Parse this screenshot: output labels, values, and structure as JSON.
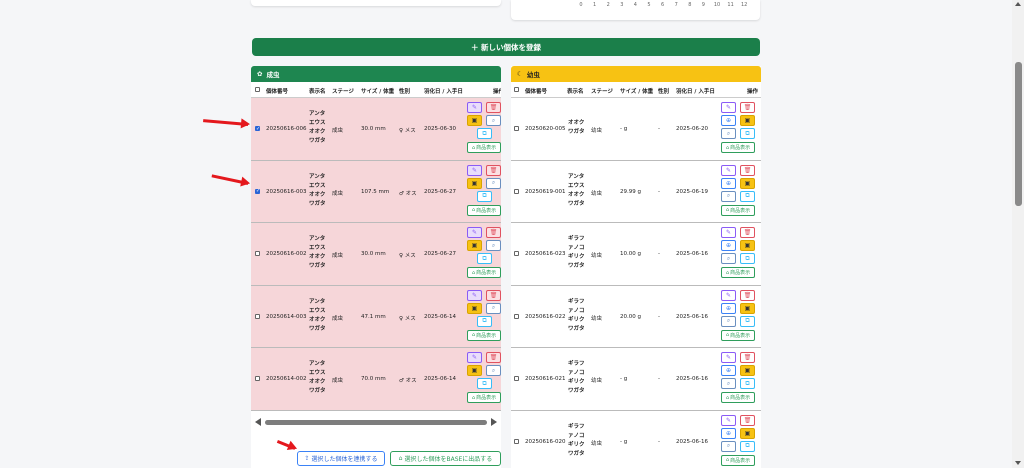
{
  "chart": {
    "x_ticks": [
      "0",
      "1",
      "2",
      "3",
      "4",
      "5",
      "6",
      "7",
      "8",
      "9",
      "10",
      "11",
      "12"
    ]
  },
  "add_button": {
    "label": "＋ 新しい個体を登録"
  },
  "columns": {
    "id": "個体番号",
    "name": "表示名",
    "stage": "ステージ",
    "size": "サイズ / 体重",
    "sex": "性別",
    "date": "羽化日 / 入手日",
    "actions": "操作"
  },
  "adults": {
    "title": "成虫",
    "rows": [
      {
        "checked": true,
        "id": "20250616-006",
        "name": "アンタエウスオオクワガタ",
        "stage": "成虫",
        "size": "30.0 mm",
        "sex": "♀ メス",
        "date": "2025-06-30"
      },
      {
        "checked": true,
        "id": "20250616-003",
        "name": "アンタエウスオオクワガタ",
        "stage": "成虫",
        "size": "107.5 mm",
        "sex": "♂ オス",
        "date": "2025-06-27"
      },
      {
        "checked": false,
        "id": "20250616-002",
        "name": "アンタエウスオオクワガタ",
        "stage": "成虫",
        "size": "30.0 mm",
        "sex": "♀ メス",
        "date": "2025-06-27"
      },
      {
        "checked": false,
        "id": "20250614-003",
        "name": "アンタエウスオオクワガタ",
        "stage": "成虫",
        "size": "47.1 mm",
        "sex": "♀ メス",
        "date": "2025-06-14"
      },
      {
        "checked": false,
        "id": "20250614-002",
        "name": "アンタエウスオオクワガタ",
        "stage": "成虫",
        "size": "70.0 mm",
        "sex": "♂ オス",
        "date": "2025-06-14"
      }
    ]
  },
  "larvae": {
    "title": "幼虫",
    "rows": [
      {
        "checked": false,
        "id": "20250620-005",
        "name": "オオクワガタ",
        "stage": "幼虫",
        "size": "- g",
        "sex": "-",
        "date": "2025-06-20"
      },
      {
        "checked": false,
        "id": "20250619-001",
        "name": "アンタエウスオオクワガタ",
        "stage": "幼虫",
        "size": "29.99 g",
        "sex": "-",
        "date": "2025-06-19"
      },
      {
        "checked": false,
        "id": "20250616-023",
        "name": "ギラファノコギリクワガタ",
        "stage": "幼虫",
        "size": "10.00 g",
        "sex": "-",
        "date": "2025-06-16"
      },
      {
        "checked": false,
        "id": "20250616-022",
        "name": "ギラファノコギリクワガタ",
        "stage": "幼虫",
        "size": "20.00 g",
        "sex": "-",
        "date": "2025-06-16"
      },
      {
        "checked": false,
        "id": "20250616-021",
        "name": "ギラファノコギリクワガタ",
        "stage": "幼虫",
        "size": "- g",
        "sex": "-",
        "date": "2025-06-16"
      },
      {
        "checked": false,
        "id": "20250616-020",
        "name": "ギラファノコギリクワガタ",
        "stage": "幼虫",
        "size": "- g",
        "sex": "-",
        "date": "2025-06-16"
      }
    ]
  },
  "actions": {
    "shop_label": "商品表示"
  },
  "bottom": {
    "link_label": "選択した個体を連携する",
    "base_label": "選択した個体をBASEに出品する"
  },
  "colors": {
    "adult_header": "#1e8650",
    "larva_header": "#f7c213",
    "adult_row": "#f6d6d9",
    "add_button": "#1b7f4a"
  }
}
